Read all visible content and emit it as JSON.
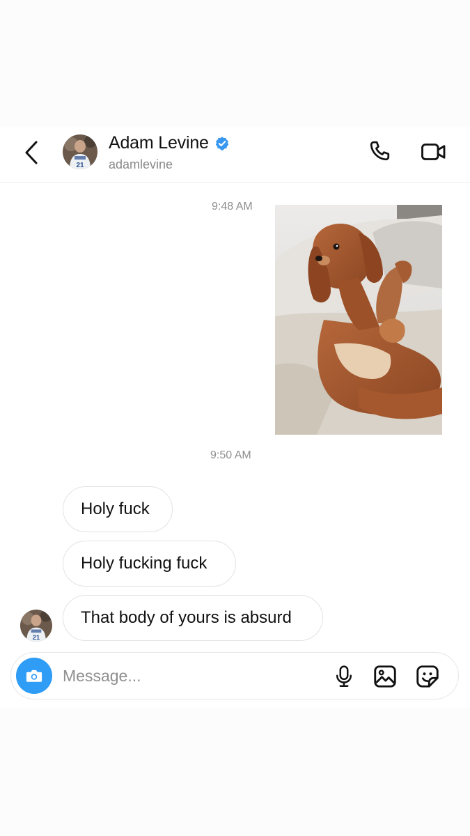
{
  "header": {
    "back_icon": "chevron-left-icon",
    "name": "Adam Levine",
    "verified_icon": "verified-badge-icon",
    "username": "adamlevine",
    "call_icon": "phone-icon",
    "video_icon": "video-camera-icon"
  },
  "messages": {
    "timestamp_1": "9:48 AM",
    "timestamp_2": "9:50 AM",
    "photo_alt": "dog photo",
    "bubbles": [
      "Holy fuck",
      "Holy fucking fuck",
      "That body of yours is absurd"
    ]
  },
  "composer": {
    "placeholder": "Message...",
    "camera_icon": "camera-icon",
    "mic_icon": "microphone-icon",
    "gallery_icon": "image-icon",
    "sticker_icon": "sticker-icon"
  },
  "colors": {
    "accent": "#2f9cf6",
    "verified": "#3897f0",
    "muted_text": "#8e8e8e",
    "bubble_border": "#e3e3e3"
  }
}
